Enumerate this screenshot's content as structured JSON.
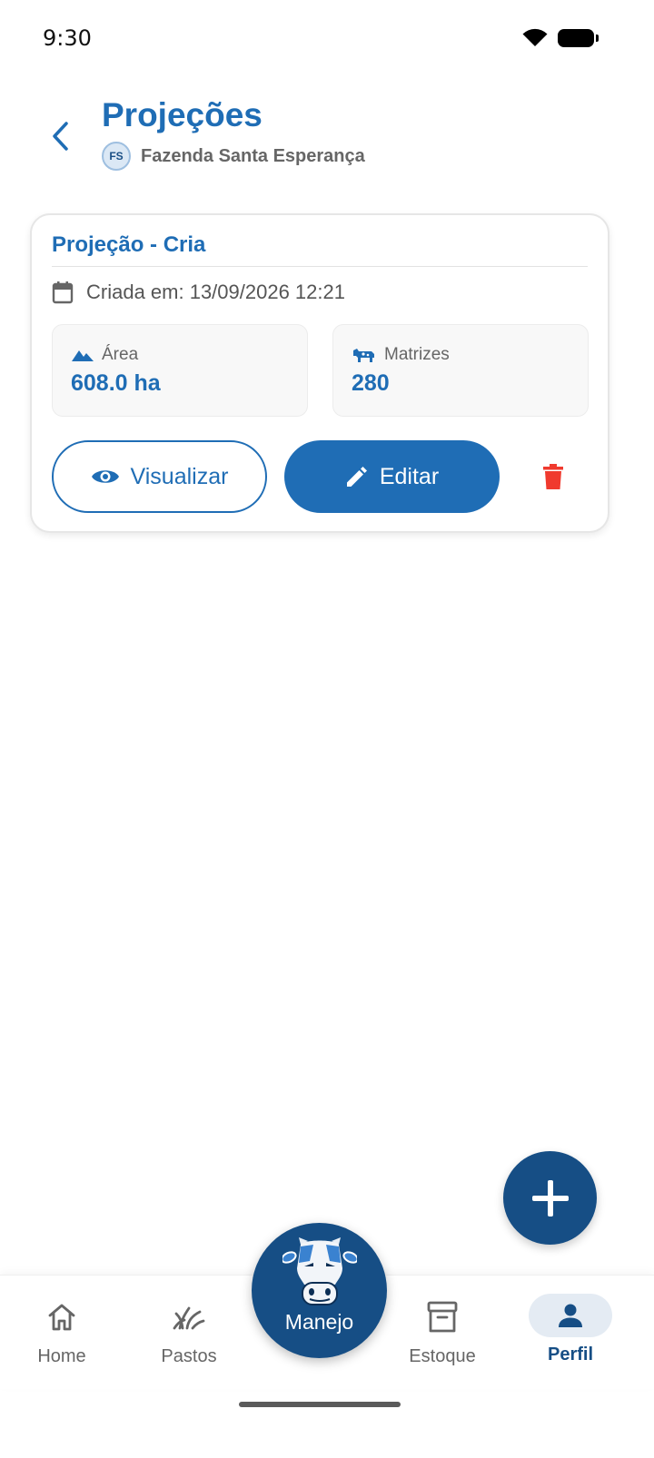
{
  "status_bar": {
    "time": "9:30"
  },
  "header": {
    "title": "Projeções",
    "farm_initials": "FS",
    "farm_name": "Fazenda Santa Esperança"
  },
  "card": {
    "title": "Projeção - Cria",
    "created": "Criada em: 13/09/2026 12:21",
    "area": {
      "label": "Área",
      "value": "608.0 ha"
    },
    "matrizes": {
      "label": "Matrizes",
      "value": "280"
    },
    "visualizar_label": "Visualizar",
    "editar_label": "Editar"
  },
  "bottom_nav": {
    "home": "Home",
    "pastos": "Pastos",
    "manejo": "Manejo",
    "estoque": "Estoque",
    "perfil": "Perfil",
    "active": "perfil"
  },
  "colors": {
    "primary": "#1f6db5",
    "dark_primary": "#164e85",
    "danger": "#f03a2e"
  }
}
